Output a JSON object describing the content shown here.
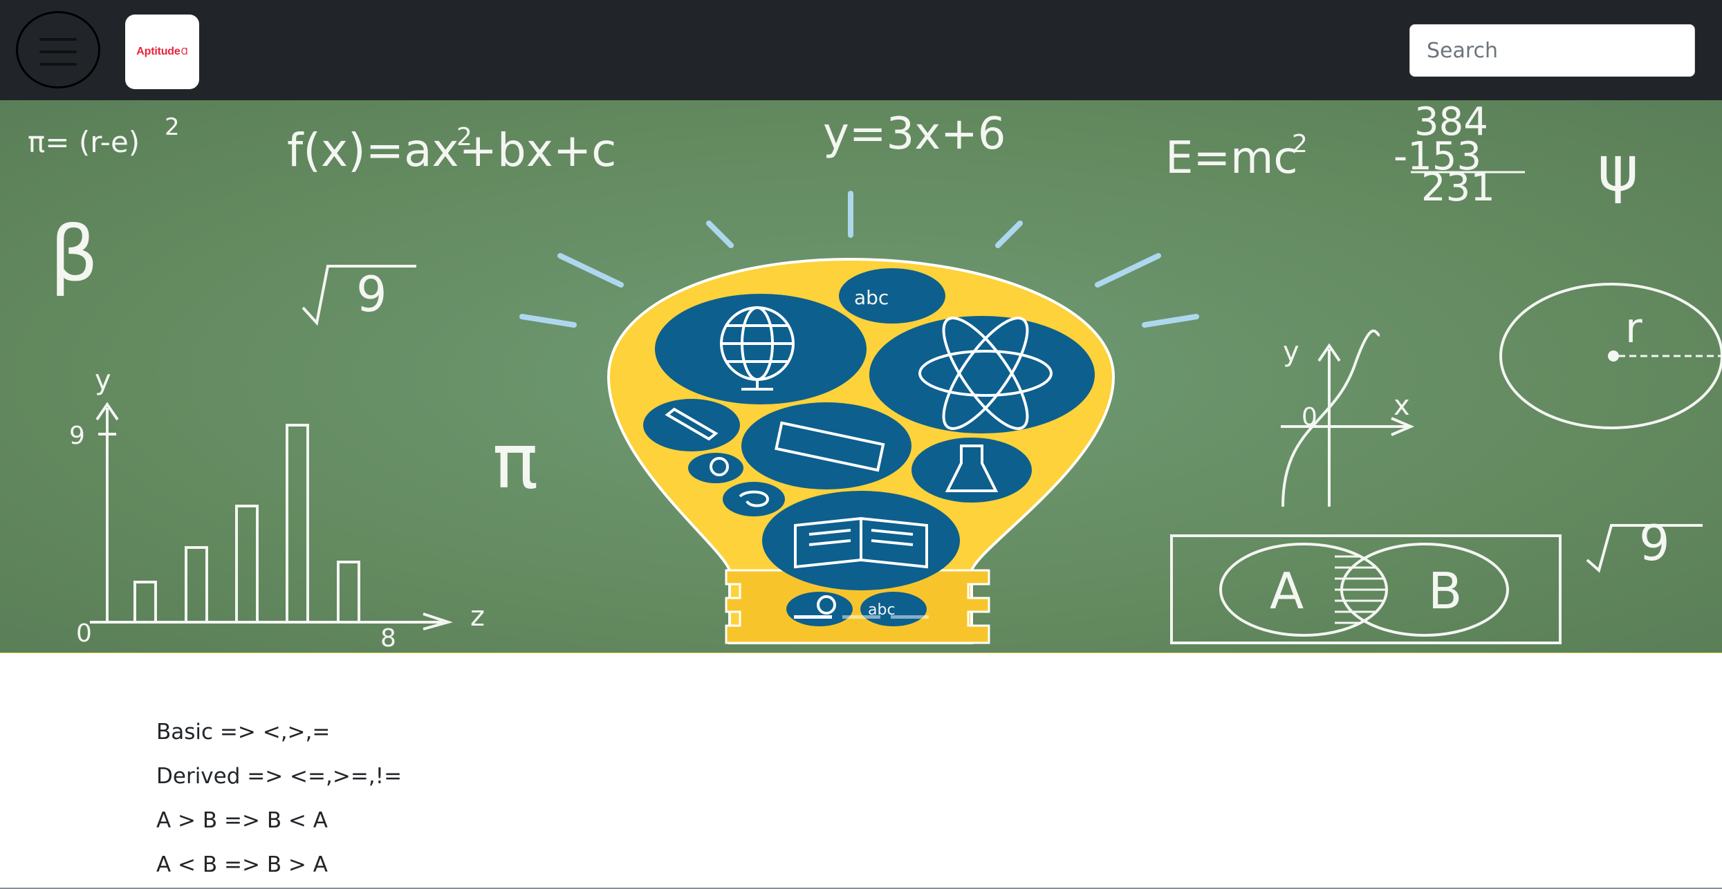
{
  "navbar": {
    "menu_icon": "hamburger-icon",
    "logo_text": "Aptitude",
    "logo_mark": "Ɑ",
    "search": {
      "placeholder": "Search",
      "value": ""
    }
  },
  "hero": {
    "formulas": {
      "pi_formula": "π= (r-e)",
      "pi_exp": "2",
      "quadratic": "f(x)=ax+bx+c",
      "quadratic_exp": "2",
      "linear": "y=3x+6",
      "energy": "E=mc",
      "energy_exp": "2",
      "sub_top": "384",
      "sub_mid": "-153",
      "sub_res": "231",
      "psi": "ψ",
      "beta": "β",
      "sqrt_left": "9",
      "pi_symbol": "π",
      "sqrt_right": "9",
      "radius": "r"
    },
    "bar_chart": {
      "y_label": "y",
      "z_label": "z",
      "origin": "0",
      "y_tick": "9",
      "x_tick": "8"
    },
    "graph": {
      "y_label": "y",
      "x_label": "x",
      "origin": "0"
    },
    "venn": {
      "left": "A",
      "right": "B"
    },
    "bulb": {
      "abc_top": "abc",
      "abc_bottom": "abc"
    },
    "carousel_indicators": 3
  },
  "content": {
    "rules": [
      "Basic => <,>,=",
      "Derived => <=,>=,!=",
      "A > B => B < A",
      "A < B => B > A"
    ]
  }
}
